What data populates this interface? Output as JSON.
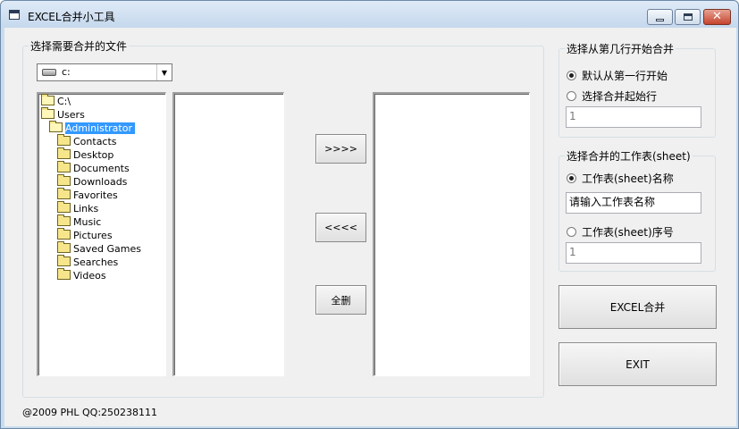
{
  "window": {
    "title": "EXCEL合并小工具"
  },
  "file_group": {
    "label": "选择需要合并的文件",
    "drive_value": "c:",
    "tree": [
      {
        "label": "C:\\",
        "level": 0,
        "open": true,
        "selected": false
      },
      {
        "label": "Users",
        "level": 0,
        "open": true,
        "selected": false
      },
      {
        "label": "Administrator",
        "level": 1,
        "open": true,
        "selected": true
      },
      {
        "label": "Contacts",
        "level": 2,
        "open": false,
        "selected": false
      },
      {
        "label": "Desktop",
        "level": 2,
        "open": false,
        "selected": false
      },
      {
        "label": "Documents",
        "level": 2,
        "open": false,
        "selected": false
      },
      {
        "label": "Downloads",
        "level": 2,
        "open": false,
        "selected": false
      },
      {
        "label": "Favorites",
        "level": 2,
        "open": false,
        "selected": false
      },
      {
        "label": "Links",
        "level": 2,
        "open": false,
        "selected": false
      },
      {
        "label": "Music",
        "level": 2,
        "open": false,
        "selected": false
      },
      {
        "label": "Pictures",
        "level": 2,
        "open": false,
        "selected": false
      },
      {
        "label": "Saved Games",
        "level": 2,
        "open": false,
        "selected": false
      },
      {
        "label": "Searches",
        "level": 2,
        "open": false,
        "selected": false
      },
      {
        "label": "Videos",
        "level": 2,
        "open": false,
        "selected": false
      }
    ],
    "add_button": ">>>>",
    "remove_button": "<<<<",
    "clear_button": "全删"
  },
  "start_row_group": {
    "label": "选择从第几行开始合并",
    "option_first": "默认从第一行开始",
    "option_custom": "选择合并起始行",
    "start_row_value": "1"
  },
  "sheet_group": {
    "label": "选择合并的工作表(sheet)",
    "option_name": "工作表(sheet)名称",
    "name_value": "请输入工作表名称",
    "option_index": "工作表(sheet)序号",
    "index_value": "1"
  },
  "actions": {
    "merge_button": "EXCEL合并",
    "exit_button": "EXIT"
  },
  "status": {
    "text": "@2009 PHL QQ:250238111"
  }
}
